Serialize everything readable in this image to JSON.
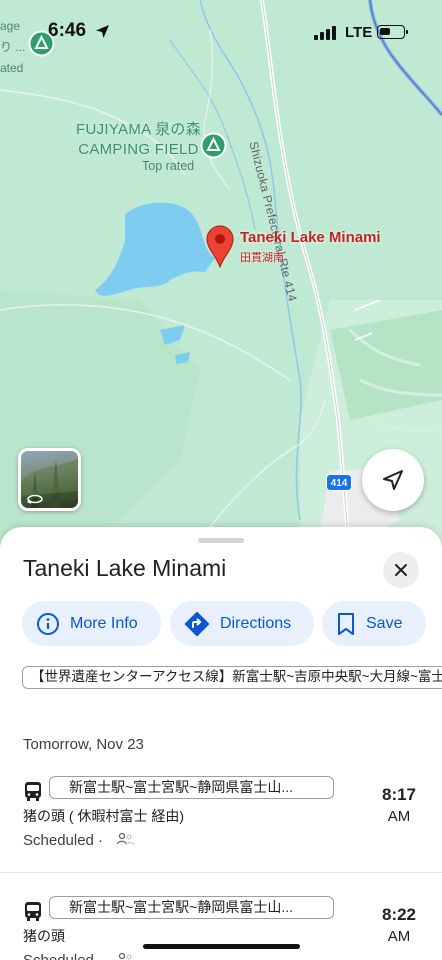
{
  "status_bar": {
    "time": "6:46",
    "network": "LTE"
  },
  "map": {
    "corner_label_lines": [
      "age",
      "り ...",
      "ated"
    ],
    "camping": {
      "name_line1": "FUJIYAMA 泉の森",
      "name_line2": "CAMPING FIELD",
      "rating": "Top rated"
    },
    "road_label": "Shizuoka Prefectural Rte 414",
    "route_badge": "414",
    "selected_place": {
      "name": "Taneki Lake Minami",
      "local_name": "田貫湖南"
    },
    "colors": {
      "land": "#bfe9d2",
      "water": "#7ecdf0",
      "pin": "#ea4335",
      "accent": "#1a73e8"
    }
  },
  "sheet": {
    "title": "Taneki Lake Minami",
    "buttons": {
      "more_info": "More Info",
      "directions": "Directions",
      "save": "Save"
    },
    "route_line": "【世界遺産センターアクセス線】新富士駅~吉原中央駅~大月線~富士",
    "date": "Tomorrow, Nov 23",
    "trips": [
      {
        "stops": "新富士駅~富士宮駅~静岡県富士山...",
        "via": "猪の頭 ( 休暇村富士 経由)",
        "status": "Scheduled ·",
        "time": "8:17",
        "ampm": "AM"
      },
      {
        "stops": "新富士駅~富士宮駅~静岡県富士山...",
        "via": "猪の頭",
        "status": "Scheduled ·",
        "time": "8:22",
        "ampm": "AM"
      }
    ]
  }
}
